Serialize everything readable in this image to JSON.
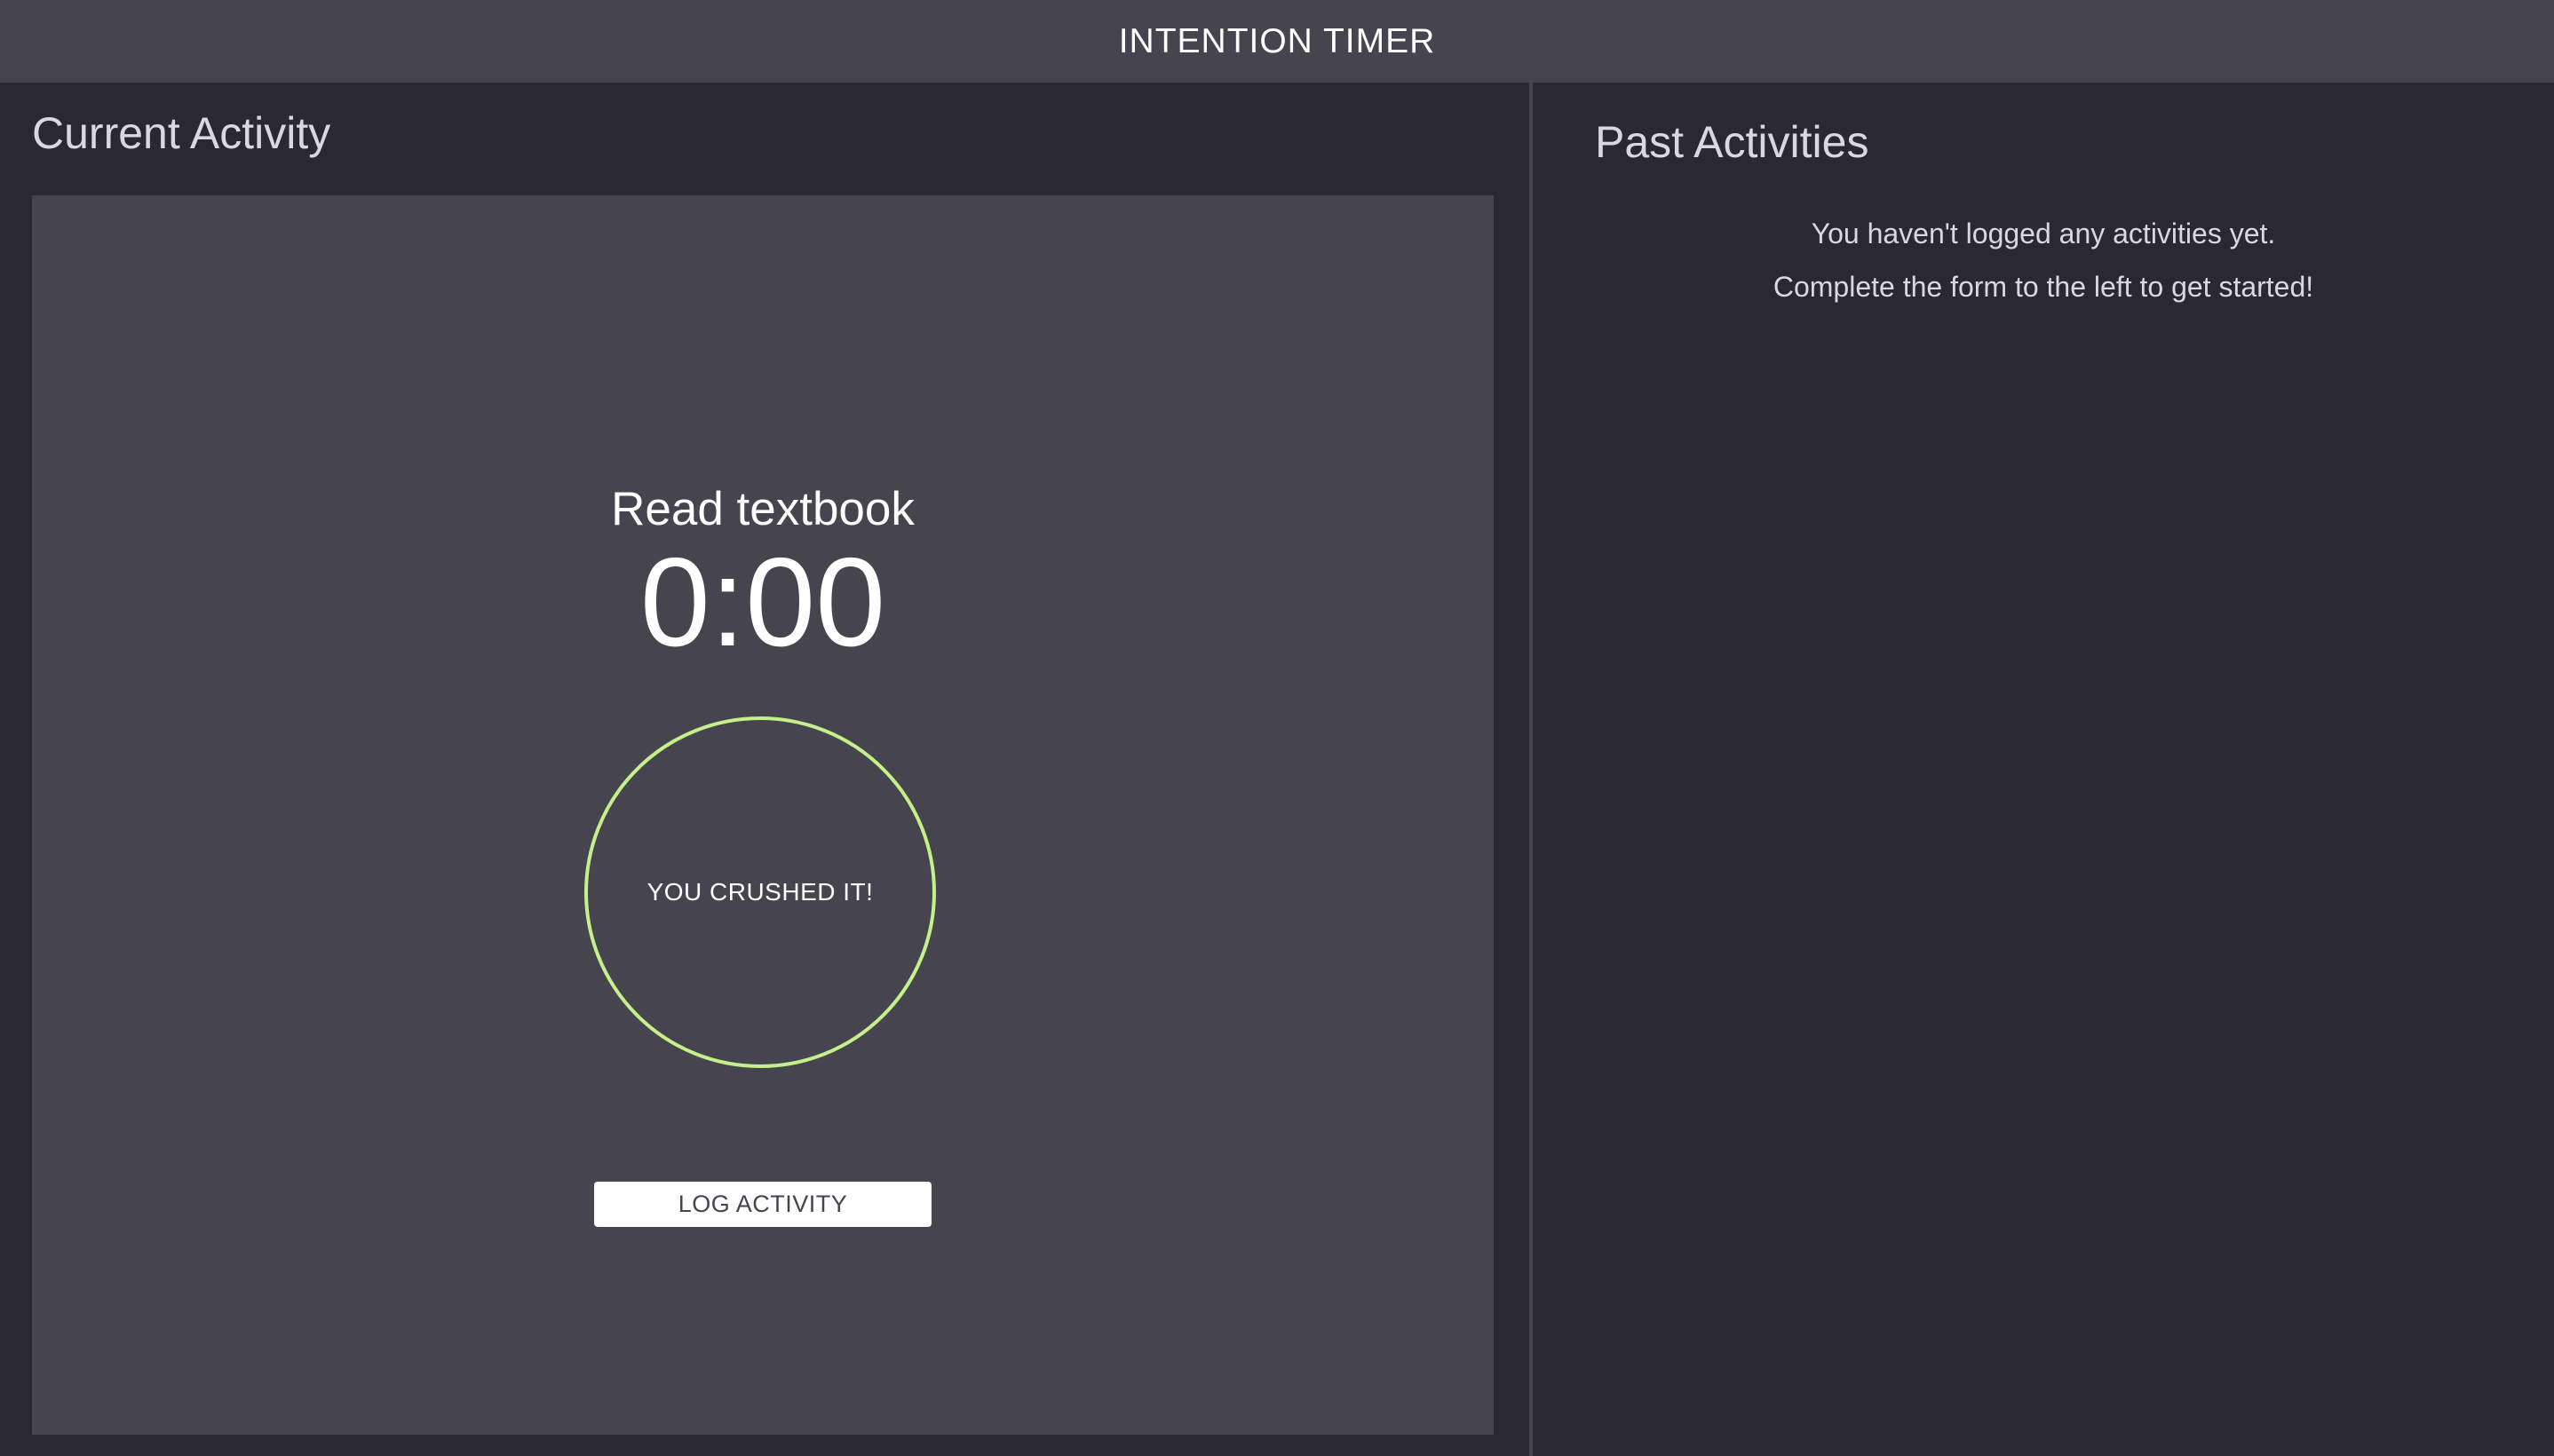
{
  "header": {
    "title": "INTENTION TIMER"
  },
  "current": {
    "section_title": "Current Activity",
    "activity_name": "Read textbook",
    "timer": "0:00",
    "ring_label": "YOU CRUSHED IT!",
    "ring_color": "#c3f08a",
    "log_button_label": "LOG ACTIVITY"
  },
  "past": {
    "section_title": "Past Activities",
    "empty_line_1": "You haven't logged any activities yet.",
    "empty_line_2": "Complete the form to the left to get started!"
  },
  "colors": {
    "background": "#2a2832",
    "panel": "#46444e",
    "accent": "#c3f08a"
  }
}
